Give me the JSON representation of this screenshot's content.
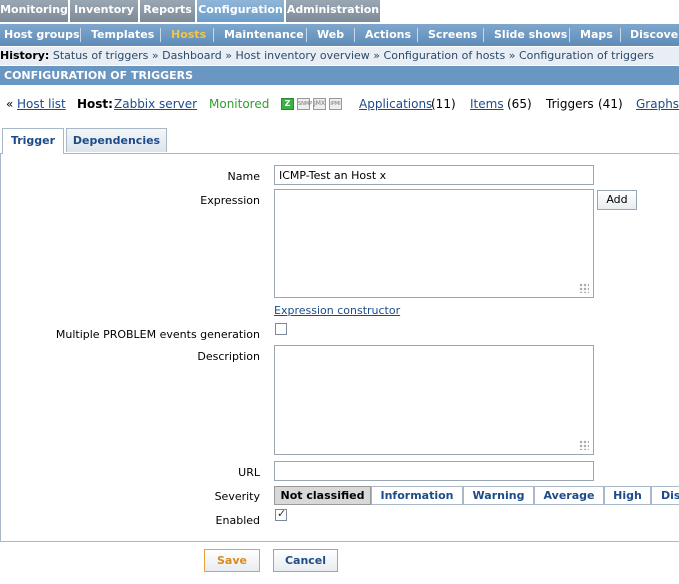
{
  "main_tabs": [
    {
      "label": "Monitoring"
    },
    {
      "label": "Inventory"
    },
    {
      "label": "Reports"
    },
    {
      "label": "Configuration",
      "active": true
    },
    {
      "label": "Administration"
    }
  ],
  "sub_nav": [
    {
      "label": "Host groups"
    },
    {
      "label": "Templates"
    },
    {
      "label": "Hosts",
      "active": true
    },
    {
      "label": "Maintenance"
    },
    {
      "label": "Web"
    },
    {
      "label": "Actions"
    },
    {
      "label": "Screens"
    },
    {
      "label": "Slide shows"
    },
    {
      "label": "Maps"
    },
    {
      "label": "Discover"
    }
  ],
  "history": {
    "label": "History:",
    "items": [
      "Status of triggers",
      "Dashboard",
      "Host inventory overview",
      "Configuration of hosts",
      "Configuration of triggers"
    ],
    "separator": "»"
  },
  "page_title": "CONFIGURATION OF TRIGGERS",
  "host_bar": {
    "back": "«",
    "host_list": "Host list",
    "host_label": "Host:",
    "host_name": "Zabbix server",
    "status": "Monitored",
    "icons": [
      "Z",
      "SNMP",
      "JMX",
      "IPMI"
    ],
    "applications_label": "Applications",
    "applications_count": "(11)",
    "items_label": "Items",
    "items_count": "(65)",
    "triggers_label": "Triggers",
    "triggers_count": "(41)",
    "graphs_label": "Graphs"
  },
  "form_tabs": [
    {
      "label": "Trigger",
      "active": true
    },
    {
      "label": "Dependencies"
    }
  ],
  "form": {
    "name_label": "Name",
    "name_value": "ICMP-Test an Host x",
    "expression_label": "Expression",
    "expression_value": "",
    "add_label": "Add",
    "expression_constructor": "Expression constructor",
    "multiple_label": "Multiple PROBLEM events generation",
    "multiple_checked": false,
    "description_label": "Description",
    "description_value": "",
    "url_label": "URL",
    "url_value": "",
    "severity_label": "Severity",
    "severities": [
      "Not classified",
      "Information",
      "Warning",
      "Average",
      "High",
      "Dis"
    ],
    "severity_selected": "Not classified",
    "enabled_label": "Enabled",
    "enabled_checked": true
  },
  "footer": {
    "save": "Save",
    "cancel": "Cancel"
  },
  "colors": {
    "accent_orange": "#e8a040",
    "header_blue": "#6a96c2",
    "link": "#1d4b8a",
    "monitored_green": "#2ea02e"
  }
}
